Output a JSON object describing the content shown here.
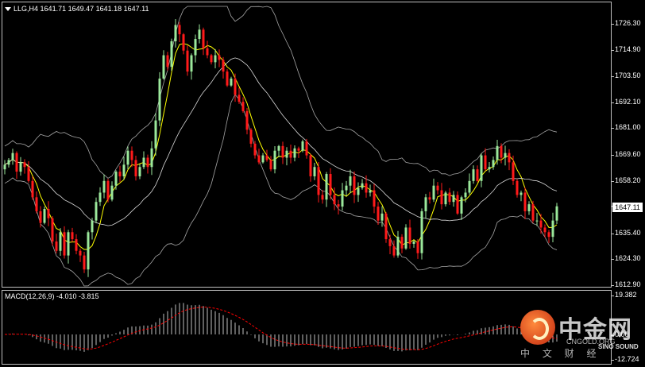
{
  "chart_header": {
    "symbol": "LLG,H4",
    "ohlc": "1641.71 1649.47 1641.18 1647.11"
  },
  "price_axis": {
    "ticks": [
      "1726.30",
      "1714.90",
      "1703.50",
      "1692.10",
      "1681.00",
      "1669.60",
      "1658.20",
      "1635.40",
      "1624.30",
      "1612.90"
    ],
    "current_price": "1647.11"
  },
  "macd": {
    "label": "MACD(12,26,9) -4.010 -3.815",
    "axis_ticks": [
      "19.382",
      "0.00",
      "-12.724"
    ]
  },
  "watermark": {
    "brand": "中金网",
    "subtitle": "中 文 财 经",
    "url": "CNGOLD.ORG",
    "sino": "SINO SOUND"
  },
  "colors": {
    "bull": "#9be89b",
    "bear": "#ff1a1a",
    "ma": "#ffff00",
    "bands": "#a6a6a6",
    "macd_signal": "#ff0000",
    "macd_hist": "#c0c0c0"
  },
  "chart_data": {
    "type": "candlestick",
    "y_range": [
      1612.9,
      1733.0
    ],
    "close": [
      1665,
      1667,
      1670,
      1662,
      1666,
      1664,
      1658,
      1651,
      1645,
      1640,
      1646,
      1642,
      1632,
      1628,
      1636,
      1626,
      1636,
      1633,
      1628,
      1626,
      1620,
      1636,
      1641,
      1649,
      1653,
      1658,
      1650,
      1656,
      1662,
      1660,
      1665,
      1671,
      1667,
      1660,
      1664,
      1668,
      1664,
      1672,
      1684,
      1702,
      1712,
      1707,
      1718,
      1725,
      1721,
      1714,
      1705,
      1712,
      1719,
      1723,
      1715,
      1712,
      1709,
      1712,
      1710,
      1705,
      1699,
      1702,
      1695,
      1692,
      1688,
      1680,
      1674,
      1669,
      1666,
      1669,
      1667,
      1663,
      1671,
      1673,
      1668,
      1671,
      1668,
      1672,
      1671,
      1675,
      1669,
      1660,
      1664,
      1652,
      1650,
      1661,
      1652,
      1648,
      1647,
      1654,
      1656,
      1660,
      1652,
      1655,
      1657,
      1653,
      1654,
      1647,
      1641,
      1644,
      1633,
      1630,
      1626,
      1634,
      1629,
      1638,
      1631,
      1632,
      1627,
      1645,
      1651,
      1650,
      1656,
      1654,
      1648,
      1653,
      1649,
      1652,
      1644,
      1651,
      1653,
      1658,
      1663,
      1658,
      1669,
      1663,
      1664,
      1667,
      1673,
      1668,
      1670,
      1666,
      1658,
      1652,
      1653,
      1645,
      1648,
      1641,
      1641,
      1638,
      1636,
      1634,
      1641,
      1647.11
    ]
  }
}
